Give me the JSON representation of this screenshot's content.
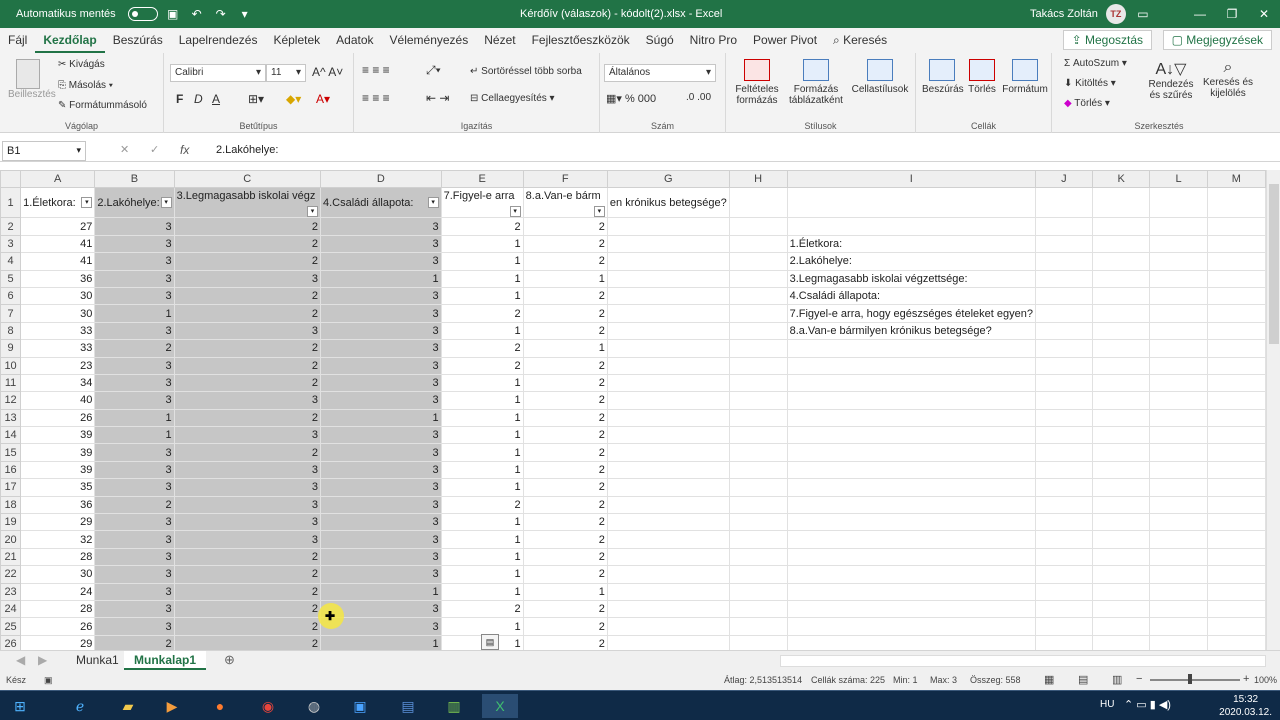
{
  "titlebar": {
    "autosave_label": "Automatikus mentés",
    "title": "Kérdőív (válaszok) - kódolt(2).xlsx - Excel",
    "user": "Takács Zoltán",
    "user_initials": "TZ"
  },
  "ribbon_tabs": [
    "Fájl",
    "Kezdőlap",
    "Beszúrás",
    "Lapelrendezés",
    "Képletek",
    "Adatok",
    "Véleményezés",
    "Nézet",
    "Fejlesztőeszközök",
    "Súgó",
    "Nitro Pro",
    "Power Pivot",
    "Keresés"
  ],
  "ribbon_buttons": {
    "share": "Megosztás",
    "comments": "Megjegyzések"
  },
  "ribbon": {
    "paste": "Beillesztés",
    "cut": "Kivágás",
    "copy": "Másolás",
    "format_painter": "Formátummásoló",
    "clipboard": "Vágólap",
    "font_name": "Calibri",
    "font_size": "11",
    "bold": "F",
    "italic": "D",
    "underline": "A",
    "font": "Betűtípus",
    "wrap": "Sortöréssel több sorba",
    "merge": "Cellaegyesítés",
    "alignment": "Igazítás",
    "number_format": "Általános",
    "number": "Szám",
    "cond_format_1": "Feltételes",
    "cond_format_2": "formázás",
    "format_table_1": "Formázás",
    "format_table_2": "táblázatként",
    "cell_styles": "Cellastílusok",
    "styles": "Stílusok",
    "insert": "Beszúrás",
    "delete": "Törlés",
    "format": "Formátum",
    "cells": "Cellák",
    "autosum": "AutoSzum",
    "fill": "Kitöltés",
    "clear": "Törlés",
    "sort_1": "Rendezés",
    "sort_2": "és szűrés",
    "find_1": "Keresés és",
    "find_2": "kijelölés",
    "editing": "Szerkesztés"
  },
  "formula_bar": {
    "namebox": "B1",
    "content": "2.Lakóhelye:"
  },
  "columns": [
    "A",
    "B",
    "C",
    "D",
    "E",
    "F",
    "G",
    "H",
    "I",
    "J",
    "K",
    "L",
    "M"
  ],
  "headers": {
    "A": "1.Életkora:",
    "B": "2.Lakóhelye:",
    "C": "3.Legmagasabb iskolai végz",
    "D": "4.Családi állapota:",
    "E": "7.Figyel-e arra",
    "F": "8.a.Van-e bárm",
    "G": "en krónikus betegsége?"
  },
  "rows": [
    [
      27,
      3,
      2,
      3,
      2,
      2
    ],
    [
      41,
      3,
      2,
      3,
      1,
      2
    ],
    [
      41,
      3,
      2,
      3,
      1,
      2
    ],
    [
      36,
      3,
      3,
      1,
      1,
      1
    ],
    [
      30,
      3,
      2,
      3,
      1,
      2
    ],
    [
      30,
      1,
      2,
      3,
      2,
      2
    ],
    [
      33,
      3,
      3,
      3,
      1,
      2
    ],
    [
      33,
      2,
      2,
      3,
      2,
      1
    ],
    [
      23,
      3,
      2,
      3,
      2,
      2
    ],
    [
      34,
      3,
      2,
      3,
      1,
      2
    ],
    [
      40,
      3,
      3,
      3,
      1,
      2
    ],
    [
      26,
      1,
      2,
      1,
      1,
      2
    ],
    [
      39,
      1,
      3,
      3,
      1,
      2
    ],
    [
      39,
      3,
      2,
      3,
      1,
      2
    ],
    [
      39,
      3,
      3,
      3,
      1,
      2
    ],
    [
      35,
      3,
      3,
      3,
      1,
      2
    ],
    [
      36,
      2,
      3,
      3,
      2,
      2
    ],
    [
      29,
      3,
      3,
      3,
      1,
      2
    ],
    [
      32,
      3,
      3,
      3,
      1,
      2
    ],
    [
      28,
      3,
      2,
      3,
      1,
      2
    ],
    [
      30,
      3,
      2,
      3,
      1,
      2
    ],
    [
      24,
      3,
      2,
      1,
      1,
      1
    ],
    [
      28,
      3,
      2,
      3,
      2,
      2
    ],
    [
      26,
      3,
      2,
      3,
      1,
      2
    ],
    [
      29,
      2,
      2,
      1,
      1,
      2
    ],
    [
      31,
      3,
      3,
      3,
      1,
      2
    ]
  ],
  "side_list": [
    "1.Életkora:",
    "2.Lakóhelye:",
    "3.Legmagasabb iskolai végzettsége:",
    "4.Családi állapota:",
    "7.Figyel-e arra, hogy egészséges ételeket egyen?",
    "8.a.Van-e bármilyen krónikus betegsége?"
  ],
  "sheet_tabs": [
    "Munka1",
    "Munkalap1"
  ],
  "status": {
    "ready": "Kész",
    "average": "Átlag: 2,513513514",
    "count": "Cellák száma: 225",
    "min": "Min: 1",
    "max": "Max: 3",
    "sum": "Összeg: 558",
    "zoom": "100%"
  },
  "taskbar": {
    "lang": "HU",
    "time": "15:32",
    "date": "2020.03.12."
  }
}
